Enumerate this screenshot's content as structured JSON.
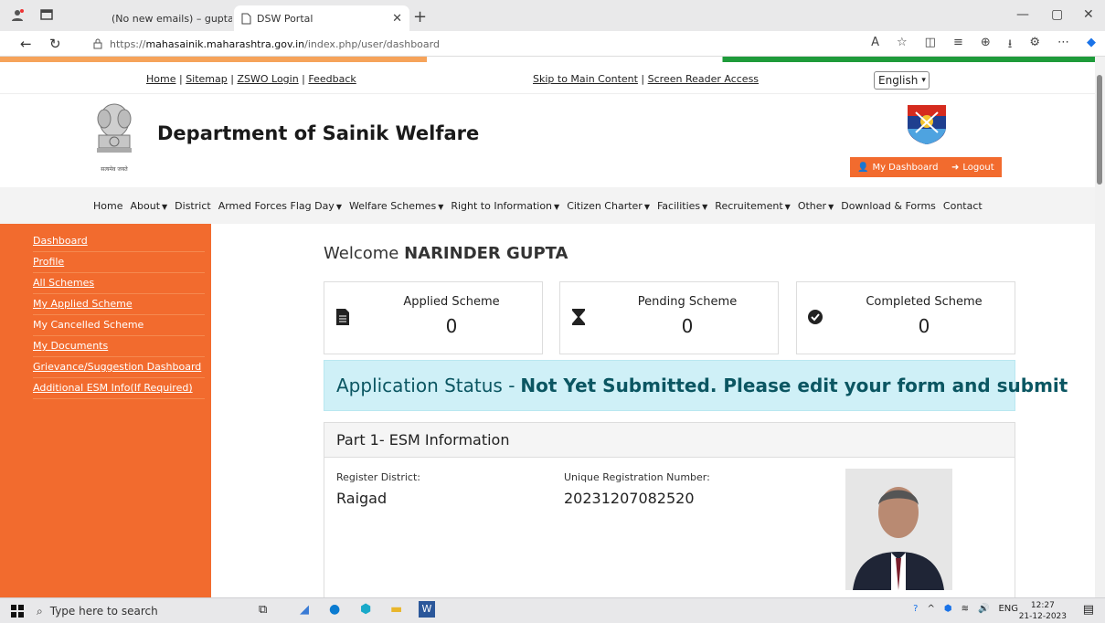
{
  "browser": {
    "tabs": [
      {
        "label": "(No new emails) – gupta.narinde",
        "active": false
      },
      {
        "label": "DSW Portal",
        "active": true
      }
    ],
    "url_prefix": "https://",
    "url_host": "mahasainik.maharashtra.gov.in",
    "url_path": "/index.php/user/dashboard"
  },
  "toplinks": {
    "left": [
      "Home",
      "Sitemap",
      "ZSWO Login",
      "Feedback"
    ],
    "mid": [
      "Skip to Main Content",
      "Screen Reader Access"
    ],
    "language": "English"
  },
  "header": {
    "emblem_caption": "सत्यमेव जयते",
    "title": "Department of Sainik Welfare",
    "dashboard_btn": "My Dashboard",
    "logout_btn": "Logout"
  },
  "menu": [
    {
      "label": "Home",
      "caret": false
    },
    {
      "label": "About",
      "caret": true
    },
    {
      "label": "District",
      "caret": false
    },
    {
      "label": "Armed Forces Flag Day",
      "caret": true
    },
    {
      "label": "Welfare Schemes",
      "caret": true
    },
    {
      "label": "Right to Information",
      "caret": true
    },
    {
      "label": "Citizen Charter",
      "caret": true
    },
    {
      "label": "Facilities",
      "caret": true
    },
    {
      "label": "Recruitement",
      "caret": true
    },
    {
      "label": "Other",
      "caret": true
    },
    {
      "label": "Download & Forms",
      "caret": false
    },
    {
      "label": "Contact",
      "caret": false
    }
  ],
  "sidebar": [
    {
      "label": "Dashboard",
      "link": true
    },
    {
      "label": "Profile",
      "link": true
    },
    {
      "label": "All Schemes",
      "link": true
    },
    {
      "label": "My Applied Scheme",
      "link": true
    },
    {
      "label": "My Cancelled Scheme",
      "link": false
    },
    {
      "label": "My Documents",
      "link": true
    },
    {
      "label": "Grievance/Suggestion Dashboard",
      "link": true
    },
    {
      "label": "Additional ESM Info(If Required)",
      "link": true
    }
  ],
  "welcome": {
    "prefix": "Welcome",
    "name": "NARINDER GUPTA"
  },
  "stats": [
    {
      "label": "Applied Scheme",
      "value": "0",
      "icon": "document-icon"
    },
    {
      "label": "Pending Scheme",
      "value": "0",
      "icon": "hourglass-icon"
    },
    {
      "label": "Completed Scheme",
      "value": "0",
      "icon": "check-circle-icon"
    }
  ],
  "status": {
    "prefix": "Application Status -",
    "message": "Not Yet Submitted. Please edit your form and submit"
  },
  "part1": {
    "title": "Part 1- ESM Information",
    "district_label": "Register District:",
    "district_value": "Raigad",
    "reg_label": "Unique Registration Number:",
    "reg_value": "20231207082520"
  },
  "taskbar": {
    "search_placeholder": "Type here to search",
    "lang": "ENG",
    "time": "12:27",
    "date": "21-12-2023"
  },
  "colors": {
    "accent": "#f26b2e",
    "status_bg": "#cff0f7",
    "status_text": "#0b5662"
  }
}
